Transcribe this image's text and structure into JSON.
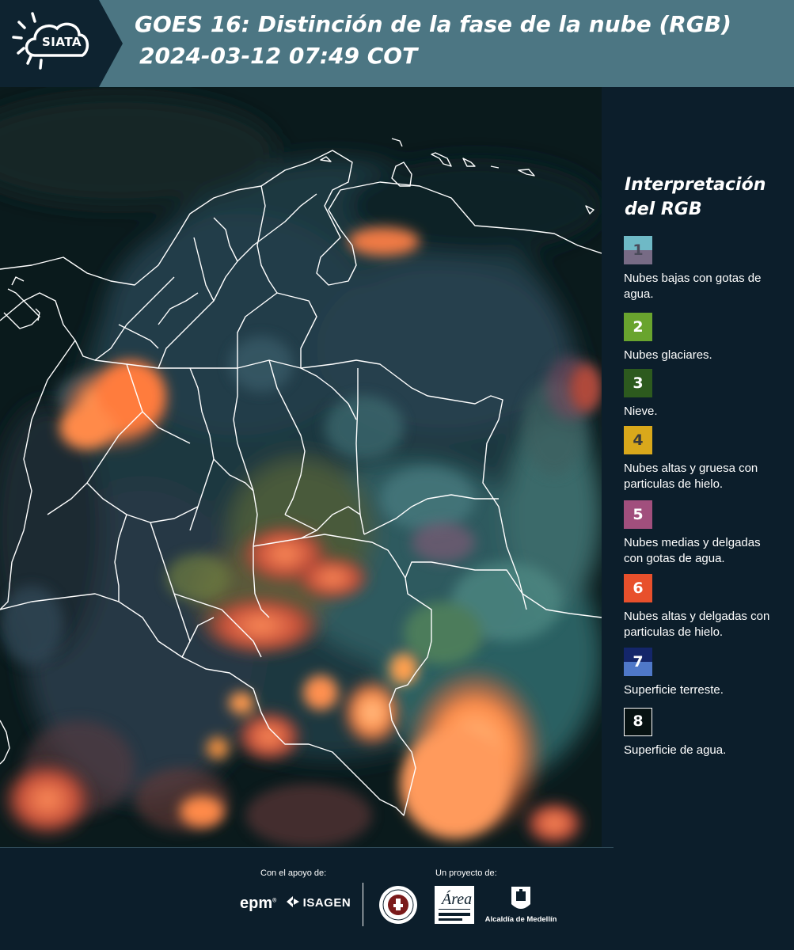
{
  "header": {
    "logo_text": "SIATA",
    "title_line1": "GOES 16: Distinción de la fase de la nube (RGB)",
    "title_line2": "2024-03-12 07:49 COT"
  },
  "legend": {
    "title": "Interpretación del RGB",
    "items": [
      {
        "number": "1",
        "label": "Nubes bajas con gotas de agua.",
        "colors": [
          "#6fb9c6",
          "#776b85"
        ],
        "text_color": "#4a4a5a"
      },
      {
        "number": "2",
        "label": "Nubes glaciares.",
        "colors": [
          "#69a42e"
        ],
        "text_color": "#ffffff"
      },
      {
        "number": "3",
        "label": "Nieve.",
        "colors": [
          "#2d5a1e"
        ],
        "text_color": "#ffffff"
      },
      {
        "number": "4",
        "label": "Nubes altas y gruesa con particulas de hielo.",
        "colors": [
          "#d9a81b"
        ],
        "text_color": "#3a3a3a"
      },
      {
        "number": "5",
        "label": "Nubes medias y delgadas con gotas de agua.",
        "colors": [
          "#a14f7d"
        ],
        "text_color": "#ffffff"
      },
      {
        "number": "6",
        "label": "Nubes altas y delgadas con particulas de hielo.",
        "colors": [
          "#e8502c"
        ],
        "text_color": "#ffffff"
      },
      {
        "number": "7",
        "label": "Superficie terreste.",
        "colors": [
          "#14266a",
          "#4f78c8"
        ],
        "text_color": "#ffffff"
      },
      {
        "number": "8",
        "label": "Superficie de agua.",
        "colors": [
          "#071212"
        ],
        "text_color": "#ffffff",
        "border": "#ffffff"
      }
    ]
  },
  "footer": {
    "support_label": "Con el apoyo de:",
    "project_label": "Un proyecto de:",
    "sponsors": [
      "epm",
      "ISAGEN"
    ],
    "partners": [
      "Área Metropolitana Valle de Aburrá",
      "Alcaldía de Medellín"
    ],
    "alcaldia_text": "Alcaldía de Medellín"
  }
}
